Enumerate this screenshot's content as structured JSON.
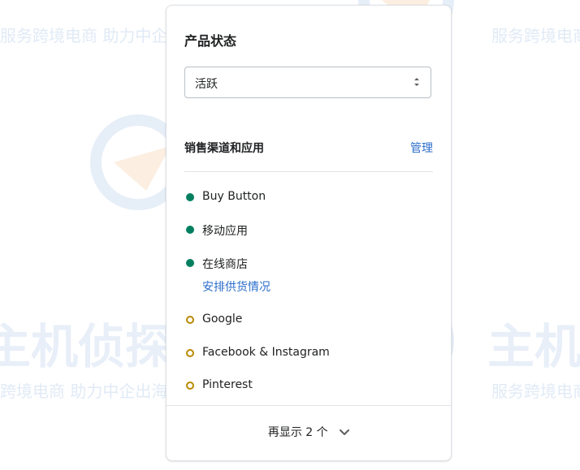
{
  "product_status": {
    "title": "产品状态",
    "selected": "活跃"
  },
  "sales_channels": {
    "title": "销售渠道和应用",
    "manage_label": "管理",
    "items": [
      {
        "label": "Buy Button",
        "status": "active"
      },
      {
        "label": "移动应用",
        "status": "active"
      },
      {
        "label": "在线商店",
        "status": "active",
        "sub_link": "安排供货情况"
      },
      {
        "label": "Google",
        "status": "inactive"
      },
      {
        "label": "Facebook & Instagram",
        "status": "inactive"
      },
      {
        "label": "Pinterest",
        "status": "inactive"
      }
    ],
    "show_more_label": "再显示 2 个"
  },
  "watermark": {
    "tagline": "服务跨境电商 助力中企出海",
    "brand": "主机侦探"
  },
  "colors": {
    "active_dot": "#007f5f",
    "inactive_dot": "#b98900",
    "link": "#2c6ecb"
  }
}
